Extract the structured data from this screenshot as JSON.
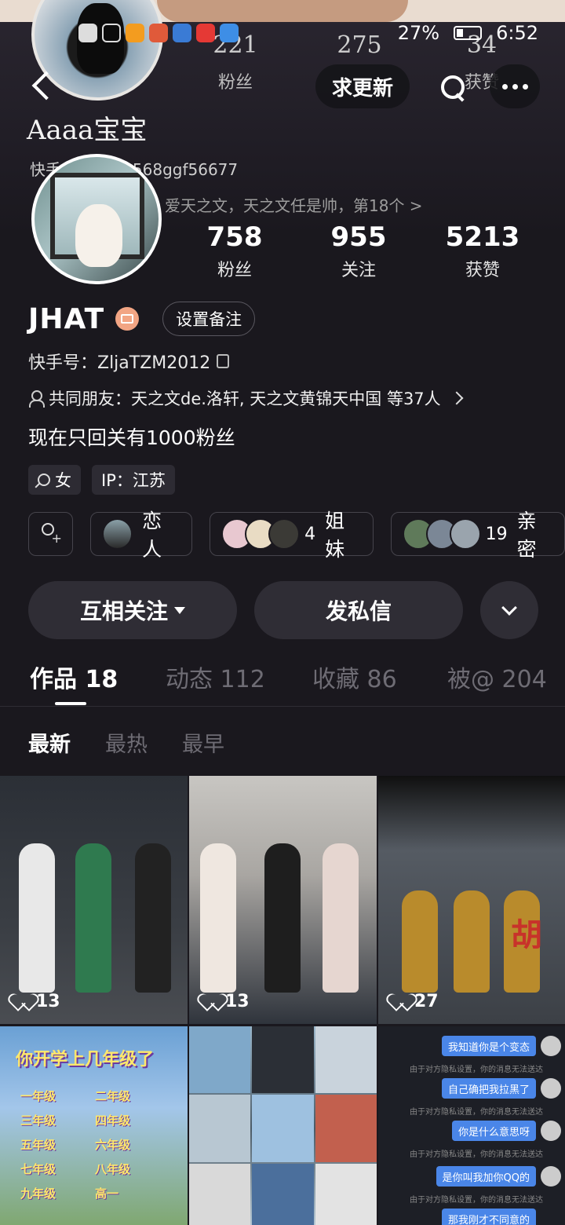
{
  "ghost": {
    "stat1_num": "221",
    "stat1_lbl": "粉丝",
    "stat2_num": "275",
    "stat3_num": "34",
    "stat3_lbl": "获赞",
    "name": "Aaaa宝宝",
    "id_text": "快手号：1234568ggf56677",
    "sig": "爱天之文，天之文任是帅，第18个 >"
  },
  "statusbar": {
    "battery": "27%",
    "time": "6:52"
  },
  "nav": {
    "update_label": "求更新"
  },
  "profile": {
    "stats": [
      {
        "num": "758",
        "label": "粉丝"
      },
      {
        "num": "955",
        "label": "关注"
      },
      {
        "num": "5213",
        "label": "获赞"
      }
    ],
    "name": "JHAT",
    "remark_label": "设置备注",
    "ks_id": "快手号：ZljaTZM2012",
    "friends": "共同朋友：天之文de.洛轩, 天之文黄锦天中国 等37人",
    "bio": "现在只回关有1000粉丝",
    "gender": "女",
    "ip": "IP：江苏"
  },
  "relations": {
    "lover": "恋人",
    "sisters_count": "4",
    "sisters": "姐妹",
    "close_count": "19",
    "close": "亲密"
  },
  "actions": {
    "follow": "互相关注",
    "message": "发私信"
  },
  "tabs": [
    {
      "label": "作品 18"
    },
    {
      "label": "动态 112"
    },
    {
      "label": "收藏 86"
    },
    {
      "label": "被@ 204"
    }
  ],
  "sort": {
    "latest": "最新",
    "hottest": "最热",
    "earliest": "最早"
  },
  "videos": [
    {
      "likes": "13"
    },
    {
      "likes": "13"
    },
    {
      "likes": "27",
      "overlay": "胡"
    },
    {
      "title": "你开学上几年级了",
      "grades": [
        "一年级",
        "二年级",
        "三年级",
        "四年级",
        "五年级",
        "六年级",
        "七年级",
        "八年级",
        "九年级",
        "高一"
      ]
    },
    {},
    {
      "chats": [
        "我知道你是个变态",
        "自己确把我拉黑了",
        "你是什么意思呀",
        "是你叫我加你QQ的",
        "那我刚才不同意的"
      ],
      "notice": "由于对方隐私设置，你的消息无法送达"
    }
  ],
  "colors": {
    "background": "#1a181e",
    "button_bg": "#2f2d35",
    "badge": "#f2a584",
    "inactive_tab": "#6e6c74"
  }
}
